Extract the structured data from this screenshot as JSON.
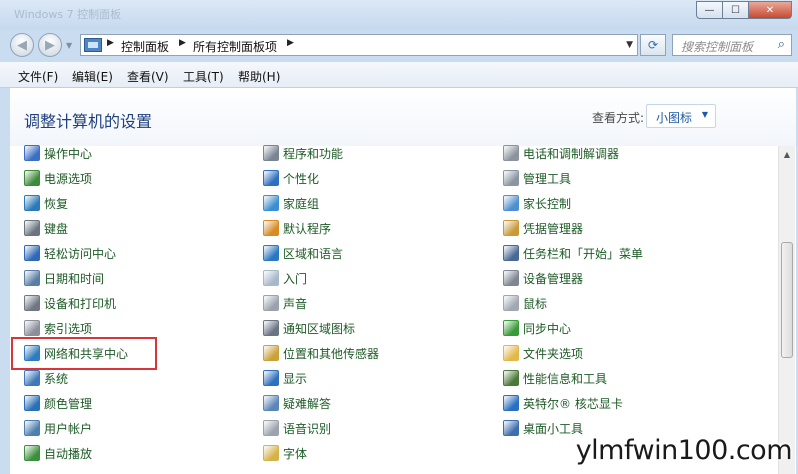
{
  "window": {
    "ghost_title": "Windows 7 控制面板",
    "controls": {
      "minimize": "—",
      "maximize": "☐",
      "close": "✕"
    }
  },
  "nav": {
    "back_icon": "back-arrow-icon",
    "forward_icon": "forward-arrow-icon",
    "breadcrumbs": [
      "控制面板",
      "所有控制面板项"
    ],
    "search_placeholder": "搜索控制面板"
  },
  "menu": [
    "文件(F)",
    "编辑(E)",
    "查看(V)",
    "工具(T)",
    "帮助(H)"
  ],
  "header": {
    "title": "调整计算机的设置",
    "view_by_label": "查看方式:",
    "view_by_value": "小图标"
  },
  "columns": [
    [
      {
        "label": "操作中心",
        "icon": "flag-icon",
        "color": "#3a6fc4"
      },
      {
        "label": "电源选项",
        "icon": "power-icon",
        "color": "#3d8a3a"
      },
      {
        "label": "恢复",
        "icon": "recovery-icon",
        "color": "#2a7ab8"
      },
      {
        "label": "键盘",
        "icon": "keyboard-icon",
        "color": "#6b7580"
      },
      {
        "label": "轻松访问中心",
        "icon": "accessibility-icon",
        "color": "#2f68b8"
      },
      {
        "label": "日期和时间",
        "icon": "clock-icon",
        "color": "#5a7fa6"
      },
      {
        "label": "设备和打印机",
        "icon": "printer-icon",
        "color": "#6f7782"
      },
      {
        "label": "索引选项",
        "icon": "index-icon",
        "color": "#8a8f99"
      },
      {
        "label": "网络和共享中心",
        "icon": "network-icon",
        "color": "#2e7bbd"
      },
      {
        "label": "系统",
        "icon": "computer-icon",
        "color": "#3f78b8"
      },
      {
        "label": "颜色管理",
        "icon": "color-icon",
        "color": "#2a6fb8"
      },
      {
        "label": "用户帐户",
        "icon": "users-icon",
        "color": "#4e7fb0"
      },
      {
        "label": "自动播放",
        "icon": "autoplay-icon",
        "color": "#3c8f3c"
      }
    ],
    [
      {
        "label": "程序和功能",
        "icon": "programs-icon",
        "color": "#7a8594"
      },
      {
        "label": "个性化",
        "icon": "display-icon",
        "color": "#2f6fbf"
      },
      {
        "label": "家庭组",
        "icon": "homegroup-icon",
        "color": "#3b8fd0"
      },
      {
        "label": "默认程序",
        "icon": "default-programs-icon",
        "color": "#d88a23"
      },
      {
        "label": "区域和语言",
        "icon": "globe-icon",
        "color": "#2b78c2"
      },
      {
        "label": "入门",
        "icon": "getting-started-icon",
        "color": "#a6b8c9"
      },
      {
        "label": "声音",
        "icon": "speaker-icon",
        "color": "#9aa3ad"
      },
      {
        "label": "通知区域图标",
        "icon": "tray-icon",
        "color": "#6a7483"
      },
      {
        "label": "位置和其他传感器",
        "icon": "sensor-icon",
        "color": "#c9a23a"
      },
      {
        "label": "显示",
        "icon": "monitor-icon",
        "color": "#2f6fbf"
      },
      {
        "label": "疑难解答",
        "icon": "troubleshoot-icon",
        "color": "#5a86b8"
      },
      {
        "label": "语音识别",
        "icon": "microphone-icon",
        "color": "#9ba4ae"
      },
      {
        "label": "字体",
        "icon": "font-icon",
        "color": "#d6b24a"
      }
    ],
    [
      {
        "label": "电话和调制解调器",
        "icon": "phone-icon",
        "color": "#8b939d"
      },
      {
        "label": "管理工具",
        "icon": "admin-tools-icon",
        "color": "#8a95a3"
      },
      {
        "label": "家长控制",
        "icon": "parental-icon",
        "color": "#4f8fcf"
      },
      {
        "label": "凭据管理器",
        "icon": "credential-icon",
        "color": "#c99a38"
      },
      {
        "label": "任务栏和「开始」菜单",
        "icon": "taskbar-icon",
        "color": "#4a6a96"
      },
      {
        "label": "设备管理器",
        "icon": "device-manager-icon",
        "color": "#7d8692"
      },
      {
        "label": "鼠标",
        "icon": "mouse-icon",
        "color": "#a0a8b2"
      },
      {
        "label": "同步中心",
        "icon": "sync-icon",
        "color": "#3a9a3a"
      },
      {
        "label": "文件夹选项",
        "icon": "folder-icon",
        "color": "#e3b84a"
      },
      {
        "label": "性能信息和工具",
        "icon": "performance-icon",
        "color": "#4a7a3a"
      },
      {
        "label": "英特尔® 核芯显卡",
        "icon": "intel-icon",
        "color": "#2a6fc0"
      },
      {
        "label": "桌面小工具",
        "icon": "gadgets-icon",
        "color": "#3d6fae"
      }
    ]
  ],
  "highlighted_item": "网络和共享中心",
  "watermark": "ylmfwin100.com"
}
